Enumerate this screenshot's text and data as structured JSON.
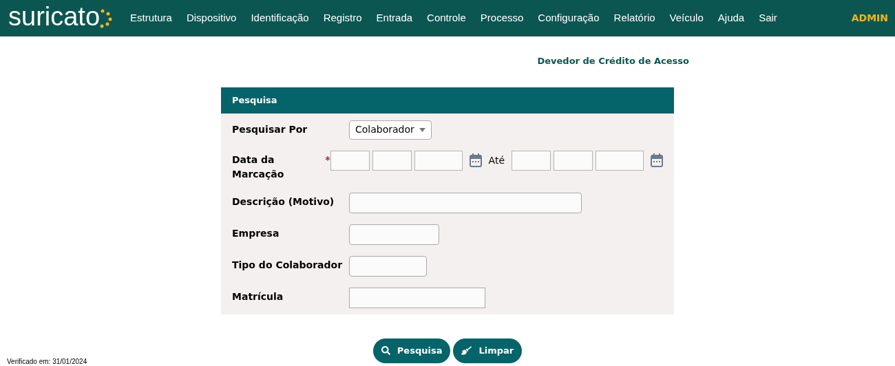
{
  "header": {
    "logo": "suricato",
    "menu": [
      "Estrutura",
      "Dispositivo",
      "Identificação",
      "Registro",
      "Entrada",
      "Controle",
      "Processo",
      "Configuração",
      "Relatório",
      "Veículo",
      "Ajuda",
      "Sair"
    ],
    "user": "ADMIN"
  },
  "page_title": "Devedor de Crédito de Acesso",
  "panel": {
    "title": "Pesquisa",
    "rows": [
      {
        "kind": "select",
        "label": "Pesquisar Por",
        "value": "Colaborador"
      },
      {
        "kind": "date-range",
        "label": "Data da Marcação",
        "required_mark": "*",
        "separator": "Até"
      },
      {
        "kind": "text",
        "label": "Descrição (Motivo)"
      },
      {
        "kind": "text",
        "label": "Empresa"
      },
      {
        "kind": "text",
        "label": "Tipo do Colaborador"
      },
      {
        "kind": "text",
        "label": "Matrícula"
      }
    ]
  },
  "buttons": [
    {
      "kind": "search",
      "label": "Pesquisa"
    },
    {
      "kind": "clear",
      "label": "Limpar"
    }
  ],
  "footer": "Verificado em: 31/01/2024"
}
